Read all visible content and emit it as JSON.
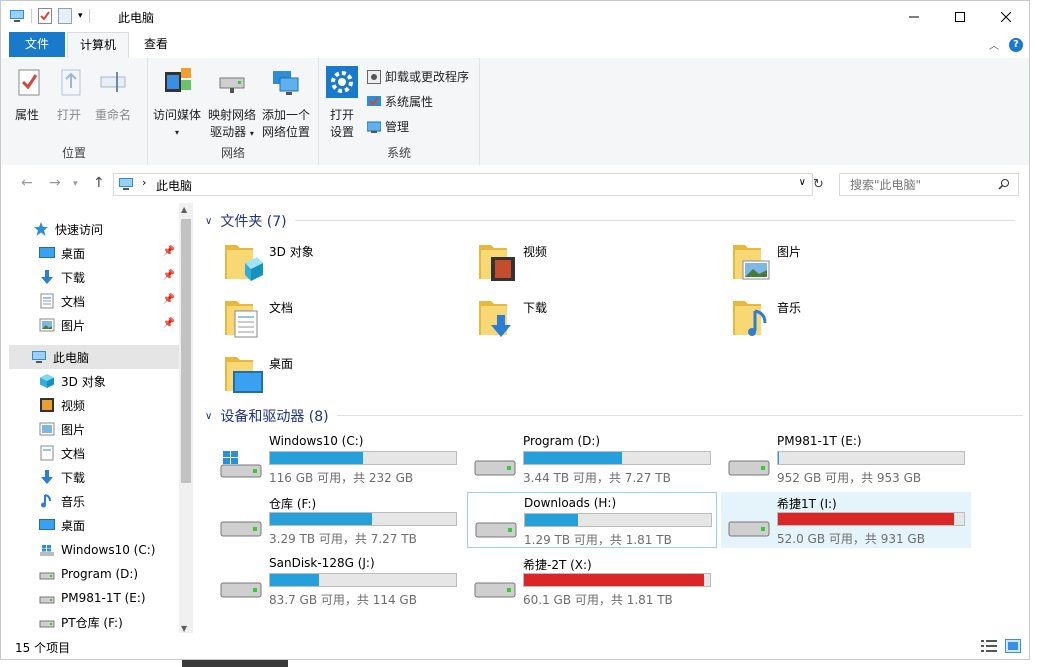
{
  "window": {
    "title": "此电脑"
  },
  "ribbon_tabs": {
    "file": "文件",
    "computer": "计算机",
    "view": "查看"
  },
  "ribbon": {
    "location": {
      "label": "位置",
      "properties": "属性",
      "open": "打开",
      "rename": "重命名"
    },
    "network": {
      "label": "网络",
      "access_media": "访问媒体",
      "map_drive_1": "映射网络",
      "map_drive_2": "驱动器",
      "add_location_1": "添加一个",
      "add_location_2": "网络位置"
    },
    "system": {
      "label": "系统",
      "open_settings_1": "打开",
      "open_settings_2": "设置",
      "uninstall": "卸载或更改程序",
      "sys_props": "系统属性",
      "manage": "管理"
    }
  },
  "address": {
    "path": "此电脑",
    "search_placeholder": "搜索\"此电脑\""
  },
  "nav": {
    "quick_access": "快速访问",
    "pinned": [
      "桌面",
      "下载",
      "文档",
      "图片"
    ],
    "this_pc": "此电脑",
    "items": [
      "3D 对象",
      "视频",
      "图片",
      "文档",
      "下载",
      "音乐",
      "桌面",
      "Windows10 (C:)",
      "Program (D:)",
      "PM981-1T (E:)",
      "PT仓库 (F:)"
    ]
  },
  "folders_section": "文件夹 (7)",
  "folders": [
    "3D 对象",
    "视频",
    "图片",
    "文档",
    "下载",
    "音乐",
    "桌面"
  ],
  "drives_section": "设备和驱动器 (8)",
  "drives": [
    {
      "name": "Windows10 (C:)",
      "info": "116 GB 可用，共 232 GB",
      "used": 0.5,
      "color": "#26a0da"
    },
    {
      "name": "Program (D:)",
      "info": "3.44 TB 可用，共 7.27 TB",
      "used": 0.527,
      "color": "#26a0da"
    },
    {
      "name": "PM981-1T (E:)",
      "info": "952 GB 可用，共 953 GB",
      "used": 0.001,
      "color": "#26a0da"
    },
    {
      "name": "仓库 (F:)",
      "info": "3.29 TB 可用，共 7.27 TB",
      "used": 0.547,
      "color": "#26a0da"
    },
    {
      "name": "Downloads (H:)",
      "info": "1.29 TB 可用，共 1.81 TB",
      "used": 0.287,
      "color": "#26a0da"
    },
    {
      "name": "希捷1T (I:)",
      "info": "52.0 GB 可用，共 931 GB",
      "used": 0.944,
      "color": "#da2626"
    },
    {
      "name": "SanDisk-128G (J:)",
      "info": "83.7 GB 可用，共 114 GB",
      "used": 0.266,
      "color": "#26a0da"
    },
    {
      "name": "希捷-2T (X:)",
      "info": "60.1 GB 可用，共 1.81 TB",
      "used": 0.968,
      "color": "#da2626"
    }
  ],
  "status": {
    "count": "15 个项目"
  }
}
